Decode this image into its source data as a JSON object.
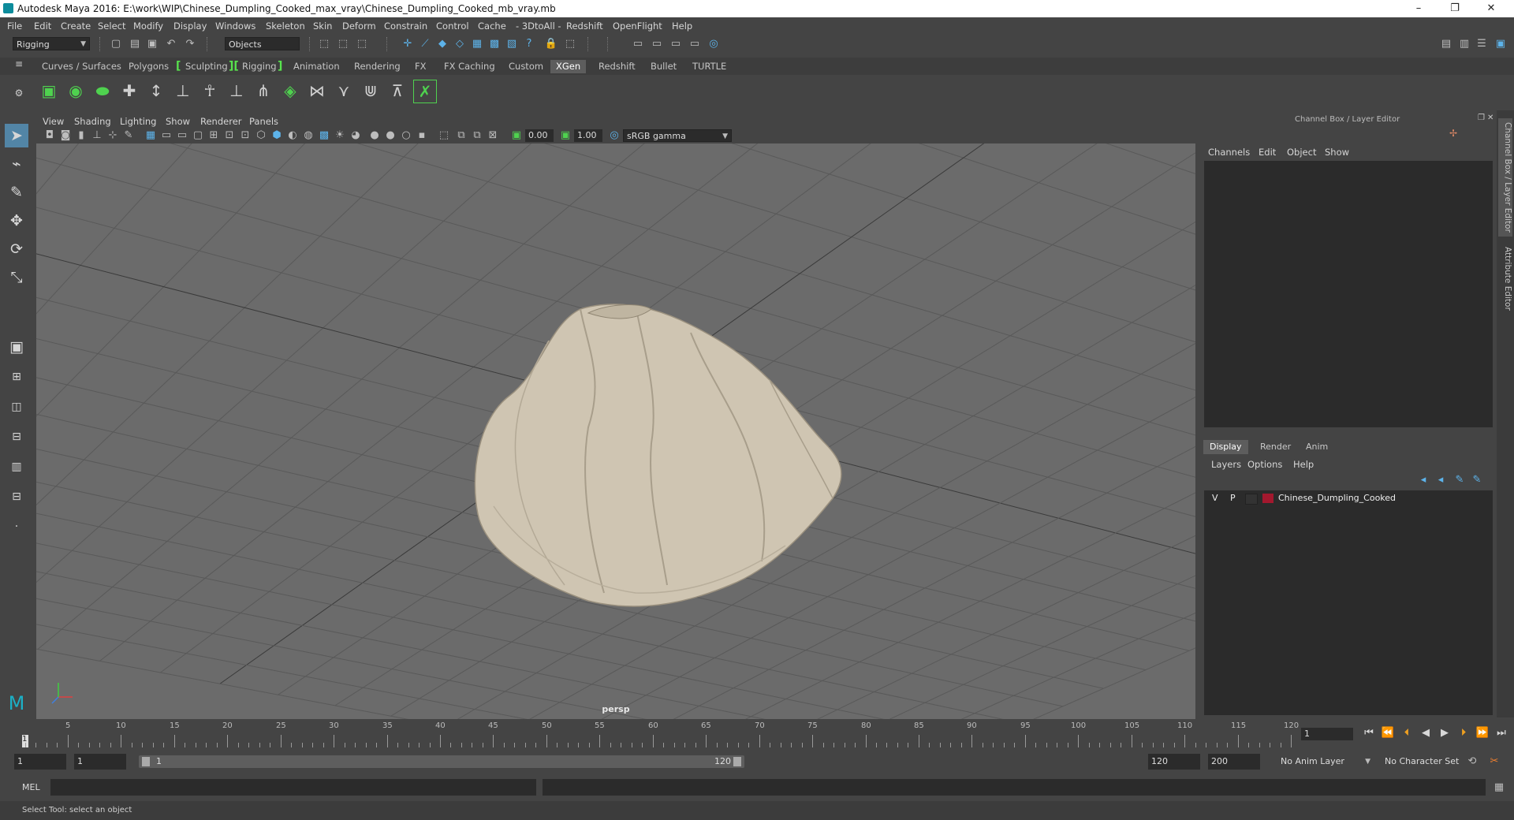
{
  "window": {
    "title": "Autodesk Maya 2016: E:\\work\\WIP\\Chinese_Dumpling_Cooked_max_vray\\Chinese_Dumpling_Cooked_mb_vray.mb",
    "minimize": "–",
    "restore": "❐",
    "close": "✕"
  },
  "menubar": [
    "File",
    "Edit",
    "Create",
    "Select",
    "Modify",
    "Display",
    "Windows",
    "Skeleton",
    "Skin",
    "Deform",
    "Constrain",
    "Control",
    "Cache",
    "- 3DtoAll -",
    "Redshift",
    "OpenFlight",
    "Help"
  ],
  "toolbar": {
    "mode": "Rigging",
    "selection_mode": "Objects"
  },
  "shelf_tabs": [
    "Curves / Surfaces",
    "Polygons",
    "Sculpting",
    "Rigging",
    "Animation",
    "Rendering",
    "FX",
    "FX Caching",
    "Custom",
    "XGen",
    "Redshift",
    "Bullet",
    "TURTLE"
  ],
  "shelf_active": "XGen",
  "viewport": {
    "menus": [
      "View",
      "Shading",
      "Lighting",
      "Show",
      "Renderer",
      "Panels"
    ],
    "exposure": "0.00",
    "gamma": "1.00",
    "color_space": "sRGB gamma",
    "camera": "persp"
  },
  "channel_box": {
    "title": "Channel Box / Layer Editor",
    "menus": [
      "Channels",
      "Edit",
      "Object",
      "Show"
    ]
  },
  "layer_editor": {
    "tabs": [
      "Display",
      "Render",
      "Anim"
    ],
    "active_tab": "Display",
    "menus": [
      "Layers",
      "Options",
      "Help"
    ],
    "layers": [
      {
        "v": "V",
        "p": "P",
        "name": "Chinese_Dumpling_Cooked",
        "color": "#a3182e"
      }
    ]
  },
  "side_tabs": [
    "Channel Box / Layer Editor",
    "Attribute Editor"
  ],
  "timeline": {
    "ticks": [
      "5",
      "10",
      "15",
      "20",
      "25",
      "30",
      "35",
      "40",
      "45",
      "50",
      "55",
      "60",
      "65",
      "70",
      "75",
      "80",
      "85",
      "90",
      "95",
      "100",
      "105",
      "110",
      "115",
      "120"
    ],
    "start_marker": "1",
    "current_frame": "1"
  },
  "range": {
    "start": "1",
    "playback_start": "1",
    "slider_start": "1",
    "slider_end": "120",
    "playback_end": "120",
    "end": "200",
    "anim_layer": "No Anim Layer",
    "character_set": "No Character Set"
  },
  "command_line": {
    "label": "MEL"
  },
  "status": {
    "help_text": "Select Tool: select an object"
  },
  "colors": {
    "accent_active": "#5285a6",
    "shelf_bracket": "#58e34d",
    "layer_color": "#a3182e",
    "viewport_bg": "#6b6b6b"
  }
}
